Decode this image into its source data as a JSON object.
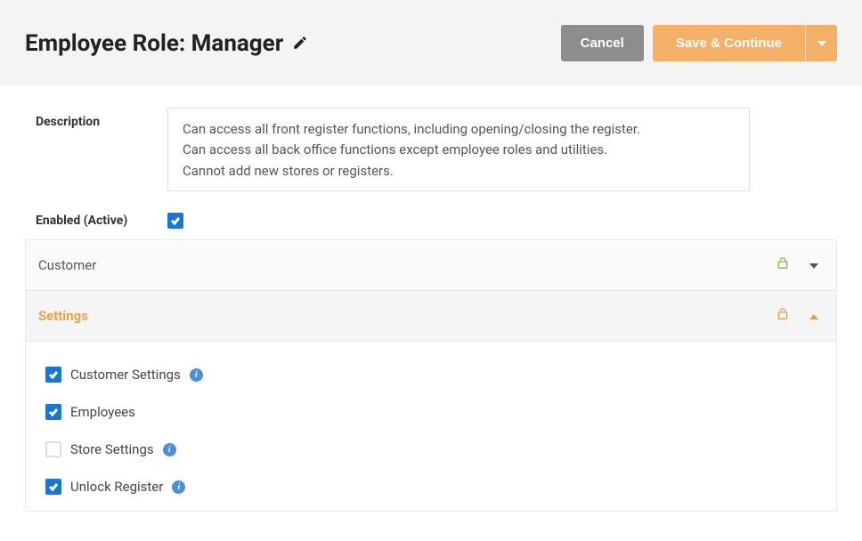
{
  "header": {
    "title": "Employee Role: Manager",
    "cancel_label": "Cancel",
    "save_label": "Save & Continue"
  },
  "fields": {
    "description_label": "Description",
    "description_value": "Can access all front register functions, including opening/closing the register.\nCan access all back office functions except employee roles and utilities.\nCannot add new stores or registers.",
    "enabled_label": "Enabled (Active)",
    "enabled_checked": true
  },
  "sections": [
    {
      "title": "Customer",
      "expanded": false,
      "lock_color": "#7bbf3a",
      "items": []
    },
    {
      "title": "Settings",
      "expanded": true,
      "lock_color": "#ec9e3e",
      "items": [
        {
          "label": "Customer Settings",
          "checked": true,
          "info": true
        },
        {
          "label": "Employees",
          "checked": true,
          "info": false
        },
        {
          "label": "Store Settings",
          "checked": false,
          "info": true
        },
        {
          "label": "Unlock Register",
          "checked": true,
          "info": true
        }
      ]
    }
  ]
}
